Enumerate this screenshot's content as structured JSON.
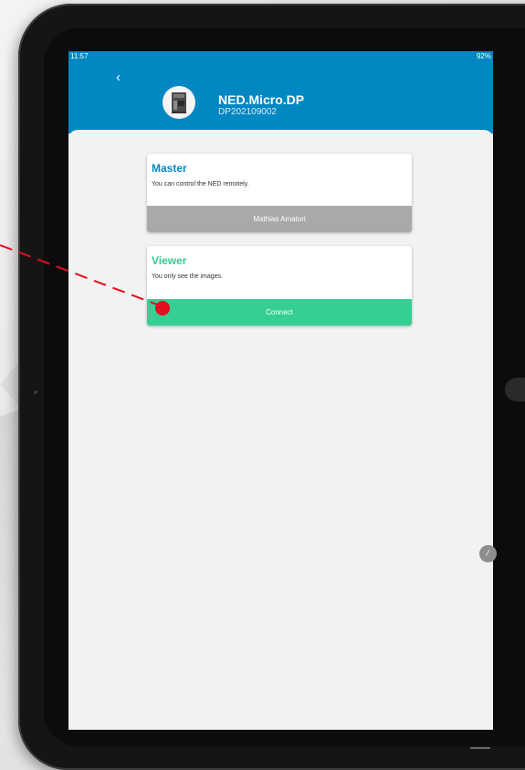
{
  "status": {
    "time": "11:57",
    "right": "92%"
  },
  "header": {
    "back_icon": "chevron-left-icon",
    "device_name": "NED.Micro.DP",
    "device_serial": "DP202109002"
  },
  "modes": {
    "master": {
      "title": "Master",
      "description": "You can control the NED remotely.",
      "button_label": "Mathias Amatori"
    },
    "viewer": {
      "title": "Viewer",
      "description": "You only see the images.",
      "button_label": "Connect"
    }
  },
  "colors": {
    "appbar": "#0187c2",
    "viewer_accent": "#36c98e",
    "connect_button": "#36cf93",
    "occupied_button": "#a9a9a9",
    "annotation": "#e0101e"
  }
}
